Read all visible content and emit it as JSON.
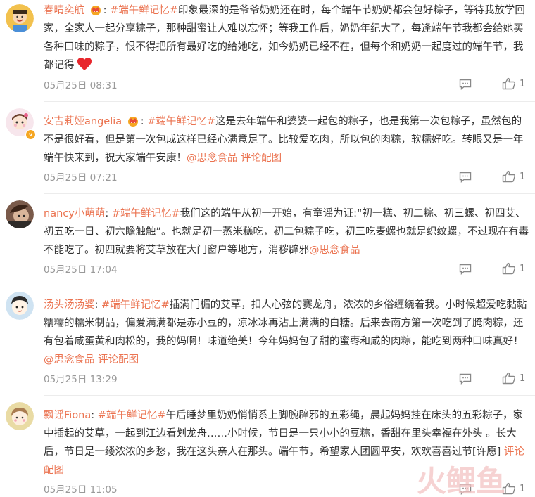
{
  "comments": [
    {
      "username": "春晴奕航",
      "tag": "#端午鲜记忆#",
      "body": "印象最深的是爷爷奶奶还在时，每个端午节奶奶都会包好粽子，等待我放学回家，全家人一起分享粽子，那种甜蜜让人难以忘怀；等我工作后，奶奶年纪大了，每逢端午节我都会给她买各种口味的粽子，恨不得把所有最好吃的给她吃，如今奶奶已经不在，但每个和奶奶一起度过的端午节，我都记得",
      "emoji": "heart-emoji",
      "links": [],
      "time": "05月25日 08:31",
      "likes": "1",
      "avatar_color": "#f2c14e",
      "verified": false
    },
    {
      "username": "安吉莉娅angelia",
      "tag": "#端午鲜记忆#",
      "body": "这是去年端午和婆婆一起包的粽子，也是我第一次包粽子，虽然包的不是很好看，但是第一次包成这样已经心满意足了。比较爱吃肉，所以包的肉粽，软糯好吃。转眼又是一年端午快来到，祝大家端午安康！",
      "links": [
        "@思念食品",
        "评论配图"
      ],
      "time": "05月25日 07:21",
      "likes": "1",
      "avatar_color": "#f7d9e3",
      "verified": true
    },
    {
      "username": "nancy小萌萌",
      "tag": "#端午鲜记忆#",
      "body": "我们这的端午从初一开始，有童谣为证:“初一糕、初二粽、初三螺、初四艾、初五吃一日、初六瞻触触”。也就是初一蒸米糕吃，初二包粽子吃，初三吃麦螺也就是织纹螺，不过现在有毒不能吃了。初四就要将艾草放在大门窗户等地方，消秽辟邪",
      "links": [
        "@思念食品"
      ],
      "time": "05月25日 17:04",
      "likes": "1",
      "avatar_color": "#7a5a4a",
      "verified": false
    },
    {
      "username": "汤头汤汤婆",
      "tag": "#端午鲜记忆#",
      "body": "插满门楣的艾草，扣人心弦的赛龙舟，浓浓的乡俗缠绕着我。小时候超爱吃黏黏糯糯的糯米制品，偏爱满满都是赤小豆的，凉冰冰再沾上满满的白糖。后来去南方第一次吃到了腌肉粽，还有包着咸蛋黄和肉松的，我的妈啊！味道绝美！今年妈妈包了甜的蜜枣和咸的肉粽，能吃到两种口味真好！",
      "links": [
        "@思念食品",
        "评论配图"
      ],
      "time": "05月25日 13:29",
      "likes": "1",
      "avatar_color": "#cfe3f2",
      "verified": false
    },
    {
      "username": "飘谣Fiona",
      "tag": "#端午鲜记忆#",
      "body": "午后睡梦里奶奶悄悄系上脚腕辟邪的五彩绳，晨起妈妈挂在床头的五彩粽子，家中插起的艾草，一起到江边看划龙舟……小时候，节日是一只小小的豆粽，香甜在里头幸福在外头 。长大后，节日是一缕浓浓的乡愁，我在这头亲人在那头。端午节，希望家人团圆平安，欢欢喜喜过节[许愿]",
      "links": [
        "评论配图"
      ],
      "time": "05月25日 11:05",
      "likes": "1",
      "avatar_color": "#e9dba4",
      "verified": false
    }
  ],
  "watermark": "火鲤鱼",
  "icons": {
    "comment": "comment-icon",
    "like": "thumbs-up-icon",
    "crown": "crown-icon"
  },
  "colors": {
    "accent": "#eb7350",
    "meta": "#999999",
    "text": "#333333"
  }
}
